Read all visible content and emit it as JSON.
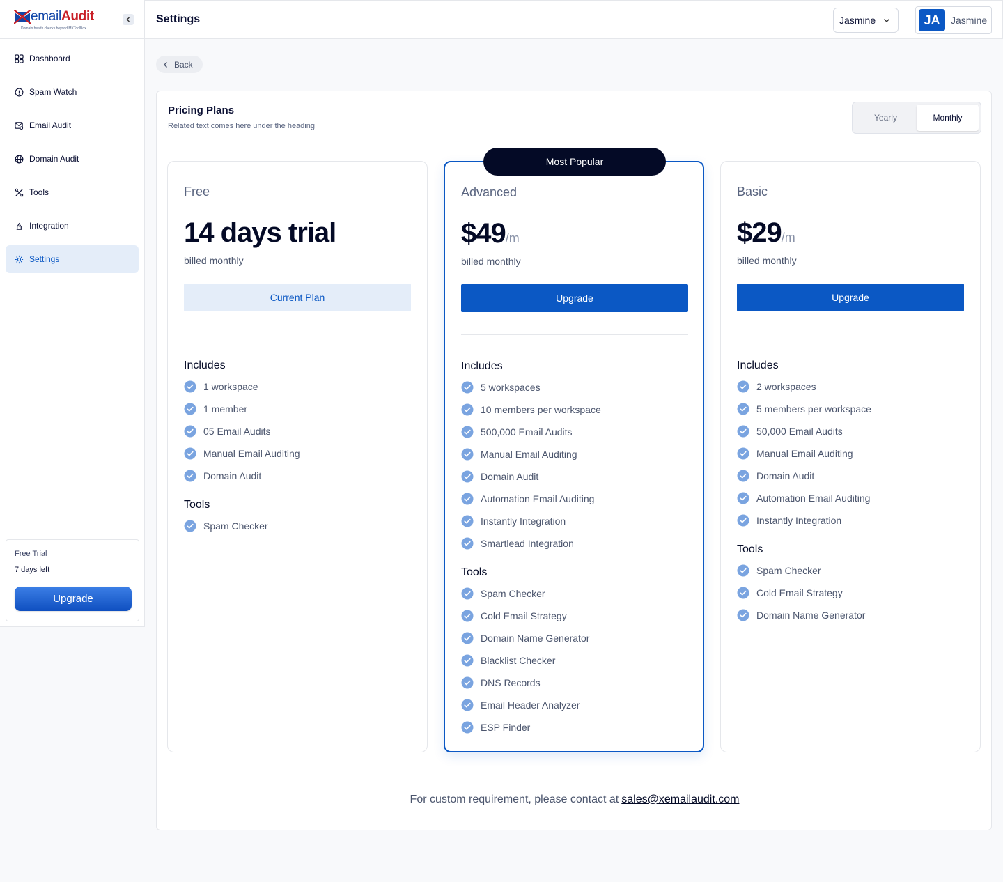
{
  "brand": {
    "name_prefix": "X",
    "name_email": "email",
    "name_audit": "Audit",
    "tagline": "Domain health checks beyond MXToolBox"
  },
  "sidebar": {
    "items": [
      {
        "label": "Dashboard",
        "icon": "grid-icon"
      },
      {
        "label": "Spam Watch",
        "icon": "alert-circle-icon"
      },
      {
        "label": "Email Audit",
        "icon": "mail-search-icon"
      },
      {
        "label": "Domain Audit",
        "icon": "globe-icon"
      },
      {
        "label": "Tools",
        "icon": "tools-icon"
      },
      {
        "label": "Integration",
        "icon": "plug-icon"
      },
      {
        "label": "Settings",
        "icon": "gear-icon",
        "active": true
      }
    ],
    "trial": {
      "title": "Free Trial",
      "days_left": "7 days left",
      "upgrade_label": "Upgrade"
    }
  },
  "header": {
    "title": "Settings",
    "workspace": "Jasmine",
    "user_initials": "JA",
    "user_name": "Jasmine"
  },
  "back_label": "Back",
  "pricing": {
    "title": "Pricing Plans",
    "subtitle": "Related text comes here under the heading",
    "toggle": {
      "yearly": "Yearly",
      "monthly": "Monthly",
      "selected": "Monthly"
    },
    "badge": "Most Popular",
    "plans": [
      {
        "name": "Free",
        "price": "14 days trial",
        "per": "",
        "billed": "billed monthly",
        "cta": "Current Plan",
        "includes_label": "Includes",
        "includes": [
          "1 workspace",
          "1 member",
          "05 Email Audits",
          "Manual Email Auditing",
          "Domain Audit"
        ],
        "tools_label": "Tools",
        "tools": [
          "Spam Checker"
        ]
      },
      {
        "name": "Advanced",
        "price": "$49",
        "per": "/m",
        "billed": "billed monthly",
        "cta": "Upgrade",
        "includes_label": "Includes",
        "includes": [
          "5 workspaces",
          "10 members per workspace",
          "500,000 Email Audits",
          "Manual Email Auditing",
          "Domain Audit",
          "Automation Email Auditing",
          "Instantly Integration",
          "Smartlead Integration"
        ],
        "tools_label": "Tools",
        "tools": [
          "Spam Checker",
          "Cold Email Strategy",
          "Domain Name Generator",
          "Blacklist Checker",
          "DNS Records",
          "Email Header Analyzer",
          "ESP Finder"
        ]
      },
      {
        "name": "Basic",
        "price": "$29",
        "per": "/m",
        "billed": "billed monthly",
        "cta": "Upgrade",
        "includes_label": "Includes",
        "includes": [
          "2 workspaces",
          "5 members per workspace",
          "50,000 Email Audits",
          "Manual Email Auditing",
          "Domain Audit",
          "Automation Email Auditing",
          "Instantly Integration"
        ],
        "tools_label": "Tools",
        "tools": [
          "Spam Checker",
          "Cold Email Strategy",
          "Domain Name Generator"
        ]
      }
    ],
    "footer_text": "For custom requirement, please contact at",
    "footer_email": "sales@xemailaudit.com"
  },
  "colors": {
    "primary": "#0b58c4",
    "dark": "#040a26",
    "check": "#7aa4e0",
    "active_bg": "#e4edf9",
    "brand_red": "#c81d25"
  }
}
